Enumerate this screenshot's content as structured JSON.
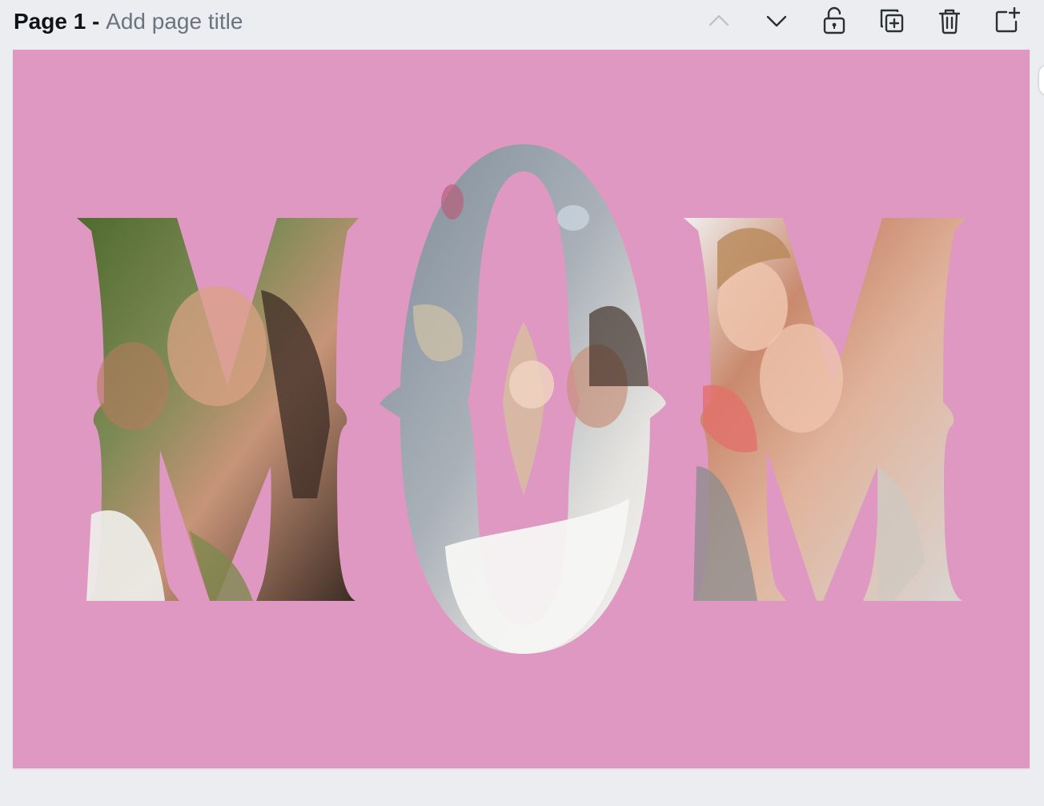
{
  "page_header": {
    "page_number": "Page 1 - ",
    "title_placeholder": "Add page title"
  },
  "toolbar": {
    "items": [
      {
        "icon": "chevron-up-icon",
        "enabled": false
      },
      {
        "icon": "chevron-down-icon",
        "enabled": true
      },
      {
        "icon": "lock-open-icon",
        "enabled": true
      },
      {
        "icon": "duplicate-page-icon",
        "enabled": true
      },
      {
        "icon": "trash-icon",
        "enabled": true
      },
      {
        "icon": "add-page-icon",
        "enabled": true
      }
    ]
  },
  "canvas": {
    "background_color": "#df98c1",
    "design": "photo collage letters",
    "letters": [
      "M",
      "O",
      "M"
    ]
  },
  "colors": {
    "app_background": "#ebedf1",
    "icon_color": "#2b3035",
    "icon_disabled": "#c0c4c9",
    "title_color": "#0e1318",
    "placeholder_color": "#6b7280"
  }
}
